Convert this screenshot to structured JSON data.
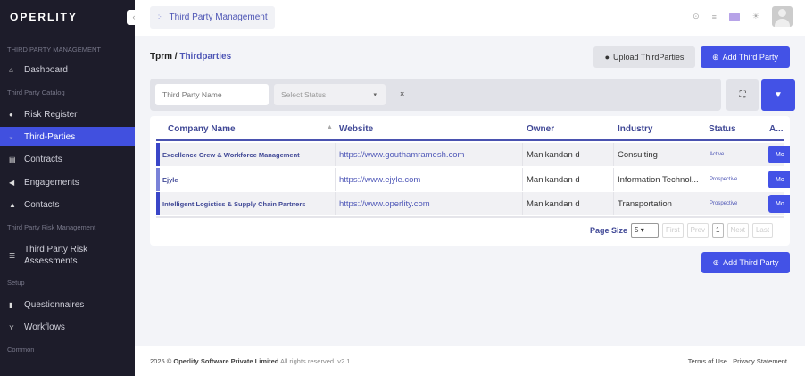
{
  "sidebar": {
    "logo": "OPERLITY",
    "sections": {
      "tpm": "THIRD PARTY MANAGEMENT",
      "catalog": "Third Party Catalog",
      "risk": "Third Party Risk Management",
      "setup": "Setup",
      "common": "Common"
    },
    "items": [
      {
        "label": "Dashboard"
      },
      {
        "label": "Risk Register"
      },
      {
        "label": "Third-Parties"
      },
      {
        "label": "Contracts"
      },
      {
        "label": "Engagements"
      },
      {
        "label": "Contacts"
      },
      {
        "label": "Third Party Risk Assessments"
      },
      {
        "label": "Questionnaires"
      },
      {
        "label": "Workflows"
      }
    ]
  },
  "header": {
    "title": "Third Party Management"
  },
  "breadcrumb": {
    "root": "Tprm",
    "sep": "/",
    "current": "Thirdparties"
  },
  "actions": {
    "upload": "Upload ThirdParties",
    "add": "Add Third Party"
  },
  "filters": {
    "name_placeholder": "Third Party Name",
    "status_placeholder": "Select Status",
    "clear": "×"
  },
  "table": {
    "columns": [
      "Company Name",
      "Website",
      "Owner",
      "Industry",
      "Status",
      "A..."
    ],
    "rows": [
      {
        "company": "Excellence Crew & Workforce Management",
        "website": "https://www.gouthamramesh.com",
        "owner": "Manikandan d",
        "industry": "Consulting",
        "status": "Active",
        "action": "Mo"
      },
      {
        "company": "Ejyle",
        "website": "https://www.ejyle.com",
        "owner": "Manikandan d",
        "industry": "Information Technol...",
        "status": "Prospective",
        "action": "Mo"
      },
      {
        "company": "Intelligent Logistics & Supply Chain Partners",
        "website": "https://www.operlity.com",
        "owner": "Manikandan d",
        "industry": "Transportation",
        "status": "Prospective",
        "action": "Mo"
      }
    ]
  },
  "pagination": {
    "label": "Page Size",
    "size": "5",
    "first": "First",
    "prev": "Prev",
    "page": "1",
    "next": "Next",
    "last": "Last"
  },
  "footer": {
    "year": "2025 ©",
    "company": "Operlity Software Private Limited",
    "rights": "All rights reserved. v2.1",
    "terms": "Terms of Use",
    "privacy": "Privacy Statement"
  }
}
